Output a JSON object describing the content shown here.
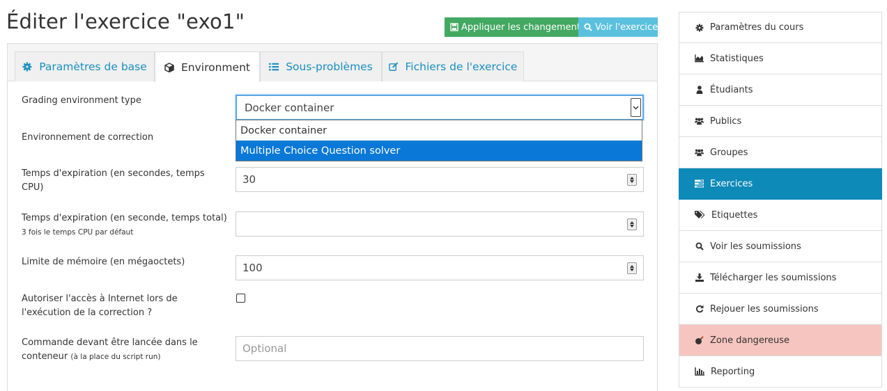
{
  "page": {
    "title": "Éditer l'exercice \"exo1\""
  },
  "actions": {
    "apply_label": "Appliquer les changements",
    "view_label": "Voir l'exercice"
  },
  "tabs": [
    {
      "label": "Paramètres de base",
      "icon": "gear-icon",
      "active": false
    },
    {
      "label": "Environment",
      "icon": "cube-icon",
      "active": true
    },
    {
      "label": "Sous-problèmes",
      "icon": "list-icon",
      "active": false
    },
    {
      "label": "Fichiers de l'exercice",
      "icon": "edit-icon",
      "active": false
    }
  ],
  "form": {
    "grading_env_type": {
      "label": "Grading environment type",
      "value": "Docker container",
      "options": [
        "Docker container",
        "Multiple Choice Question solver"
      ],
      "highlighted_option": "Multiple Choice Question solver"
    },
    "correction_env": {
      "label": "Environnement de correction"
    },
    "cpu_timeout": {
      "label": "Temps d'expiration (en secondes, temps CPU)",
      "value": "30"
    },
    "total_timeout": {
      "label": "Temps d'expiration (en seconde, temps total)",
      "hint": "3 fois le temps CPU par défaut",
      "value": ""
    },
    "memory_limit": {
      "label": "Limite de mémoire (en mégaoctets)",
      "value": "100"
    },
    "internet_access": {
      "label": "Autoriser l'accès à Internet lors de l'exécution de la correction ?",
      "checked": false
    },
    "run_command": {
      "label": "Commande devant être lancée dans le conteneur",
      "hint": "(à la place du script run)",
      "placeholder": "Optional"
    }
  },
  "sidebar": {
    "items": [
      {
        "label": "Paramètres du cours",
        "icon": "gear-icon"
      },
      {
        "label": "Statistiques",
        "icon": "area-chart-icon"
      },
      {
        "label": "Étudiants",
        "icon": "user-icon"
      },
      {
        "label": "Publics",
        "icon": "users-icon"
      },
      {
        "label": "Groupes",
        "icon": "users-icon"
      },
      {
        "label": "Exercices",
        "icon": "tasks-icon",
        "active": true
      },
      {
        "label": "Etiquettes",
        "icon": "tags-icon"
      },
      {
        "label": "Voir les soumissions",
        "icon": "search-icon"
      },
      {
        "label": "Télécharger les soumissions",
        "icon": "download-icon"
      },
      {
        "label": "Rejouer les soumissions",
        "icon": "refresh-icon"
      },
      {
        "label": "Zone dangereuse",
        "icon": "bomb-icon",
        "danger": true
      },
      {
        "label": "Reporting",
        "icon": "bar-chart-icon"
      }
    ]
  },
  "colors": {
    "accent": "#0e8ab8",
    "success": "#43a862",
    "info": "#5bc0de",
    "danger_bg": "#f6c5bf",
    "link": "#1a8fc0"
  }
}
